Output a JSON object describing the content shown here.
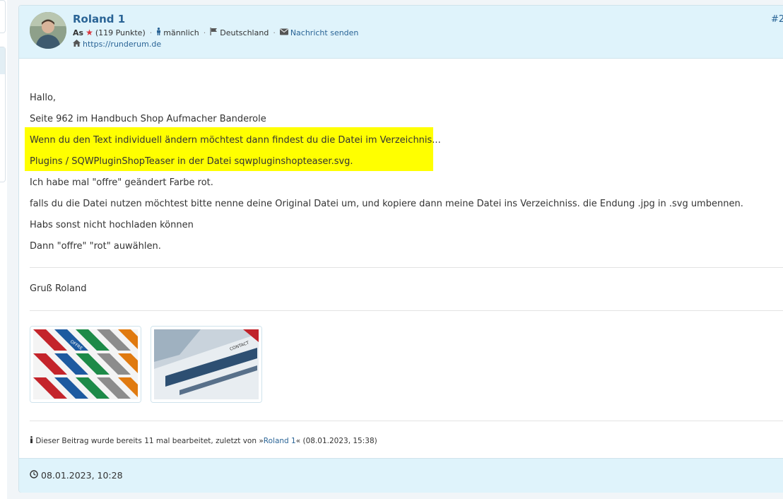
{
  "post": {
    "username": "Roland 1",
    "rank": "As",
    "points": "(119 Punkte)",
    "gender": "männlich",
    "country": "Deutschland",
    "message_link": "Nachricht senden",
    "website": "https://runderum.de",
    "number": "#2",
    "body": {
      "greeting": "Hallo,",
      "line1": "Seite 962 im Handbuch Shop Aufmacher Banderole",
      "highlight1": "Wenn du den Text individuell ändern möchtest dann findest du die Datei im Verzeichnis...",
      "highlight2": "Plugins / SQWPluginShopTeaser in der Datei sqwpluginshopteaser.svg.",
      "line2": "Ich habe mal \"offre\" geändert Farbe rot.",
      "line3": "falls du die Datei nutzen möchtest bitte nenne deine Original Datei um, und kopiere dann meine Datei ins Verzeichniss. die Endung .jpg in .svg umbennen.",
      "line4": "Habs sonst nicht hochladen können",
      "line5": "Dann \"offre\" \"rot\" auwählen."
    },
    "signature": "Gruß Roland",
    "attachments": [
      {
        "label": "OFFRE"
      },
      {
        "label": "CONTACT"
      }
    ],
    "edit_note": {
      "prefix": "Dieser Beitrag wurde bereits 11 mal bearbeitet, zuletzt von »",
      "user": "Roland 1",
      "suffix": "« (08.01.2023, 15:38)"
    },
    "date": "08.01.2023, 10:28"
  },
  "colors": {
    "accent": "#2a6496",
    "header_bg": "#dff3fb",
    "highlight": "#ffff00",
    "star": "#d9363e"
  }
}
